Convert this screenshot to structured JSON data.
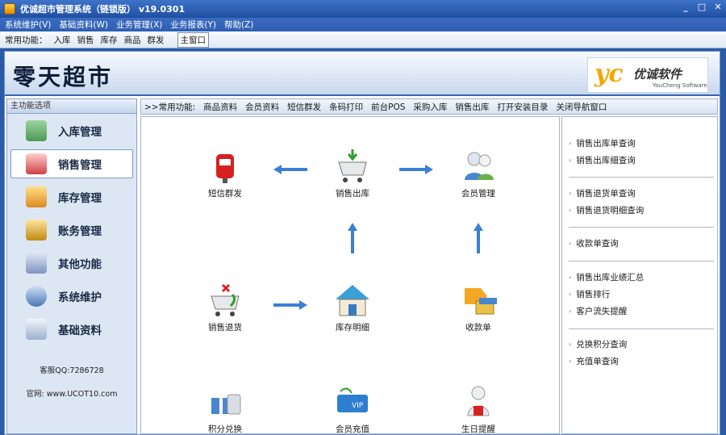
{
  "window": {
    "title": "优诚超市管理系统（链锁版） v19.0301",
    "minimize": "_",
    "maximize": "□",
    "close": "✕"
  },
  "menu": [
    "系统维护(V)",
    "基础资料(W)",
    "业务管理(X)",
    "业务报表(Y)",
    "帮助(Z)"
  ],
  "toolbar": {
    "label": "常用功能：",
    "items": [
      "入库",
      "销售",
      "库存",
      "商品",
      "群发"
    ],
    "main_window": "主窗口"
  },
  "banner": {
    "store_name": "零天超市",
    "logo_mark": "yc",
    "logo_cn": "优诚软件",
    "logo_en": "YouCheng Software"
  },
  "sidebar": {
    "header": "主功能选项",
    "items": [
      {
        "label": "入库管理",
        "icon": "warehouse-icon"
      },
      {
        "label": "销售管理",
        "icon": "shopping-cart-icon"
      },
      {
        "label": "库存管理",
        "icon": "house-icon"
      },
      {
        "label": "账务管理",
        "icon": "money-magnifier-icon"
      },
      {
        "label": "其他功能",
        "icon": "tools-icon"
      },
      {
        "label": "系统维护",
        "icon": "gear-icon"
      },
      {
        "label": "基础资料",
        "icon": "calendar-icon"
      }
    ],
    "qq": "客服QQ:7286728",
    "site": "官网: www.UCOT10.com"
  },
  "quick": {
    "label": ">>常用功能:",
    "items": [
      "商品资料",
      "会员资料",
      "短信群发",
      "条码打印",
      "前台POS",
      "采购入库",
      "销售出库",
      "打开安装目录",
      "关闭导航窗口"
    ]
  },
  "flow": {
    "sms": "短信群发",
    "sales_out": "销售出库",
    "member": "会员管理",
    "return": "销售退货",
    "stock_detail": "库存明细",
    "receipt": "收款单",
    "points": "积分兑换",
    "recharge": "会员充值",
    "birthday": "生日提醒"
  },
  "right_links": [
    [
      "销售出库单查询",
      "销售出库细查询"
    ],
    [
      "销售退货单查询",
      "销售退货明细查询"
    ],
    [
      "收款单查询"
    ],
    [
      "销售出库业绩汇总",
      "销售排行",
      "客户流失提醒"
    ],
    [
      "兑换积分查询",
      "充值单查询"
    ]
  ]
}
